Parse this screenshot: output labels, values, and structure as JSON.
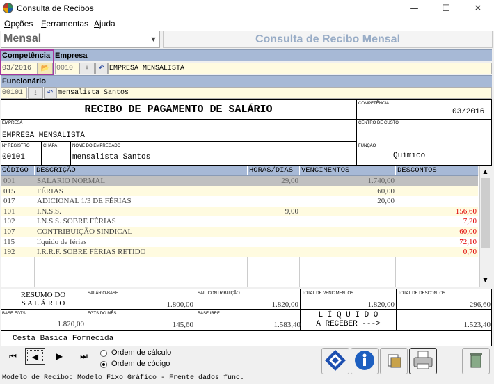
{
  "window": {
    "title": "Consulta de Recibos",
    "minimize": "—",
    "maximize": "☐",
    "close": "✕"
  },
  "menu": [
    {
      "label": "Opções",
      "key": "O"
    },
    {
      "label": "Ferramentas",
      "key": "F"
    },
    {
      "label": "Ajuda",
      "key": "A"
    }
  ],
  "header": {
    "type_select": "Mensal",
    "heading": "Consulta de Recibo Mensal"
  },
  "form": {
    "competencia_label": "Competência",
    "competencia_value": "03/2016",
    "empresa_label": "Empresa",
    "empresa_code": "0010",
    "empresa_name": "EMPRESA MENSALISTA",
    "funcionario_label": "Funcionário",
    "funcionario_code": "00101",
    "funcionario_name": "mensalista Santos"
  },
  "receipt": {
    "title": "RECIBO DE PAGAMENTO DE SALÁRIO",
    "competencia_label": "COMPETÊNCIA",
    "competencia": "03/2016",
    "empresa_label": "EMPRESA",
    "empresa": "EMPRESA MENSALISTA",
    "centro_label": "CENTRO DE CUSTO",
    "centro": "",
    "registro_label": "Nº REGISTRO",
    "registro": "00101",
    "chapa_label": "CHAPA",
    "chapa": "",
    "nome_label": "NOME DO EMPREGADO",
    "nome": "mensalista Santos",
    "funcao_label": "FUNÇÃO",
    "funcao": "Químico"
  },
  "table": {
    "columns": [
      "CÓDIGO",
      "DESCRIÇÃO",
      "HORAS/DIAS",
      "VENCIMENTOS",
      "DESCONTOS"
    ],
    "rows": [
      {
        "codigo": "001",
        "descricao": "SALÁRIO NORMAL",
        "horas": "29,00",
        "vencimentos": "1.740,00",
        "descontos": ""
      },
      {
        "codigo": "015",
        "descricao": "FÉRIAS",
        "horas": "",
        "vencimentos": "60,00",
        "descontos": ""
      },
      {
        "codigo": "017",
        "descricao": "ADICIONAL 1/3 DE FÉRIAS",
        "horas": "",
        "vencimentos": "20,00",
        "descontos": ""
      },
      {
        "codigo": "101",
        "descricao": "I.N.S.S.",
        "horas": "9,00",
        "vencimentos": "",
        "descontos": "156,60"
      },
      {
        "codigo": "102",
        "descricao": "I.N.S.S. SOBRE FÉRIAS",
        "horas": "",
        "vencimentos": "",
        "descontos": "7,20"
      },
      {
        "codigo": "107",
        "descricao": "CONTRIBUIÇÃO SINDICAL",
        "horas": "",
        "vencimentos": "",
        "descontos": "60,00"
      },
      {
        "codigo": "115",
        "descricao": "líquido de férias",
        "horas": "",
        "vencimentos": "",
        "descontos": "72,10"
      },
      {
        "codigo": "192",
        "descricao": "I.R.R.F. SOBRE FÉRIAS RETIDO",
        "horas": "",
        "vencimentos": "",
        "descontos": "0,70"
      }
    ]
  },
  "summary": {
    "resumo_line1": "RESUMO DO",
    "resumo_line2": "S A L Á R I O",
    "salario_base_label": "SALÁRIO-BASE",
    "salario_base": "1.800,00",
    "sal_contrib_label": "SAL. CONTRIBUIÇÃO",
    "sal_contrib": "1.820,00",
    "total_venc_label": "TOTAL DE VENCIMENTOS",
    "total_venc": "1.820,00",
    "total_desc_label": "TOTAL DE DESCONTOS",
    "total_desc": "296,60",
    "base_fgts_label": "BASE FGTS",
    "base_fgts": "1.820,00",
    "fgts_mes_label": "FGTS DO MÊS",
    "fgts_mes": "145,60",
    "base_irrf_label": "BASE IRRF",
    "base_irrf": "1.583,40",
    "liquido_line1": "L Í Q U I D O",
    "liquido_line2": "A RECEBER --->",
    "liquido": "1.523,40",
    "note": "Cesta Basica Fornecida"
  },
  "footer": {
    "nav": [
      "first",
      "prev",
      "next",
      "last"
    ],
    "order_calc": "Ordem de cálculo",
    "order_code": "Ordem de código",
    "selected_order": "code",
    "status": "Modelo de Recibo: Modelo Fixo Gráfico - Frente dados func."
  },
  "colors": {
    "header_bar": "#a7b9d6",
    "field_bg": "#fffbe0",
    "highlight": "#a4369e",
    "negative": "#e00000"
  }
}
